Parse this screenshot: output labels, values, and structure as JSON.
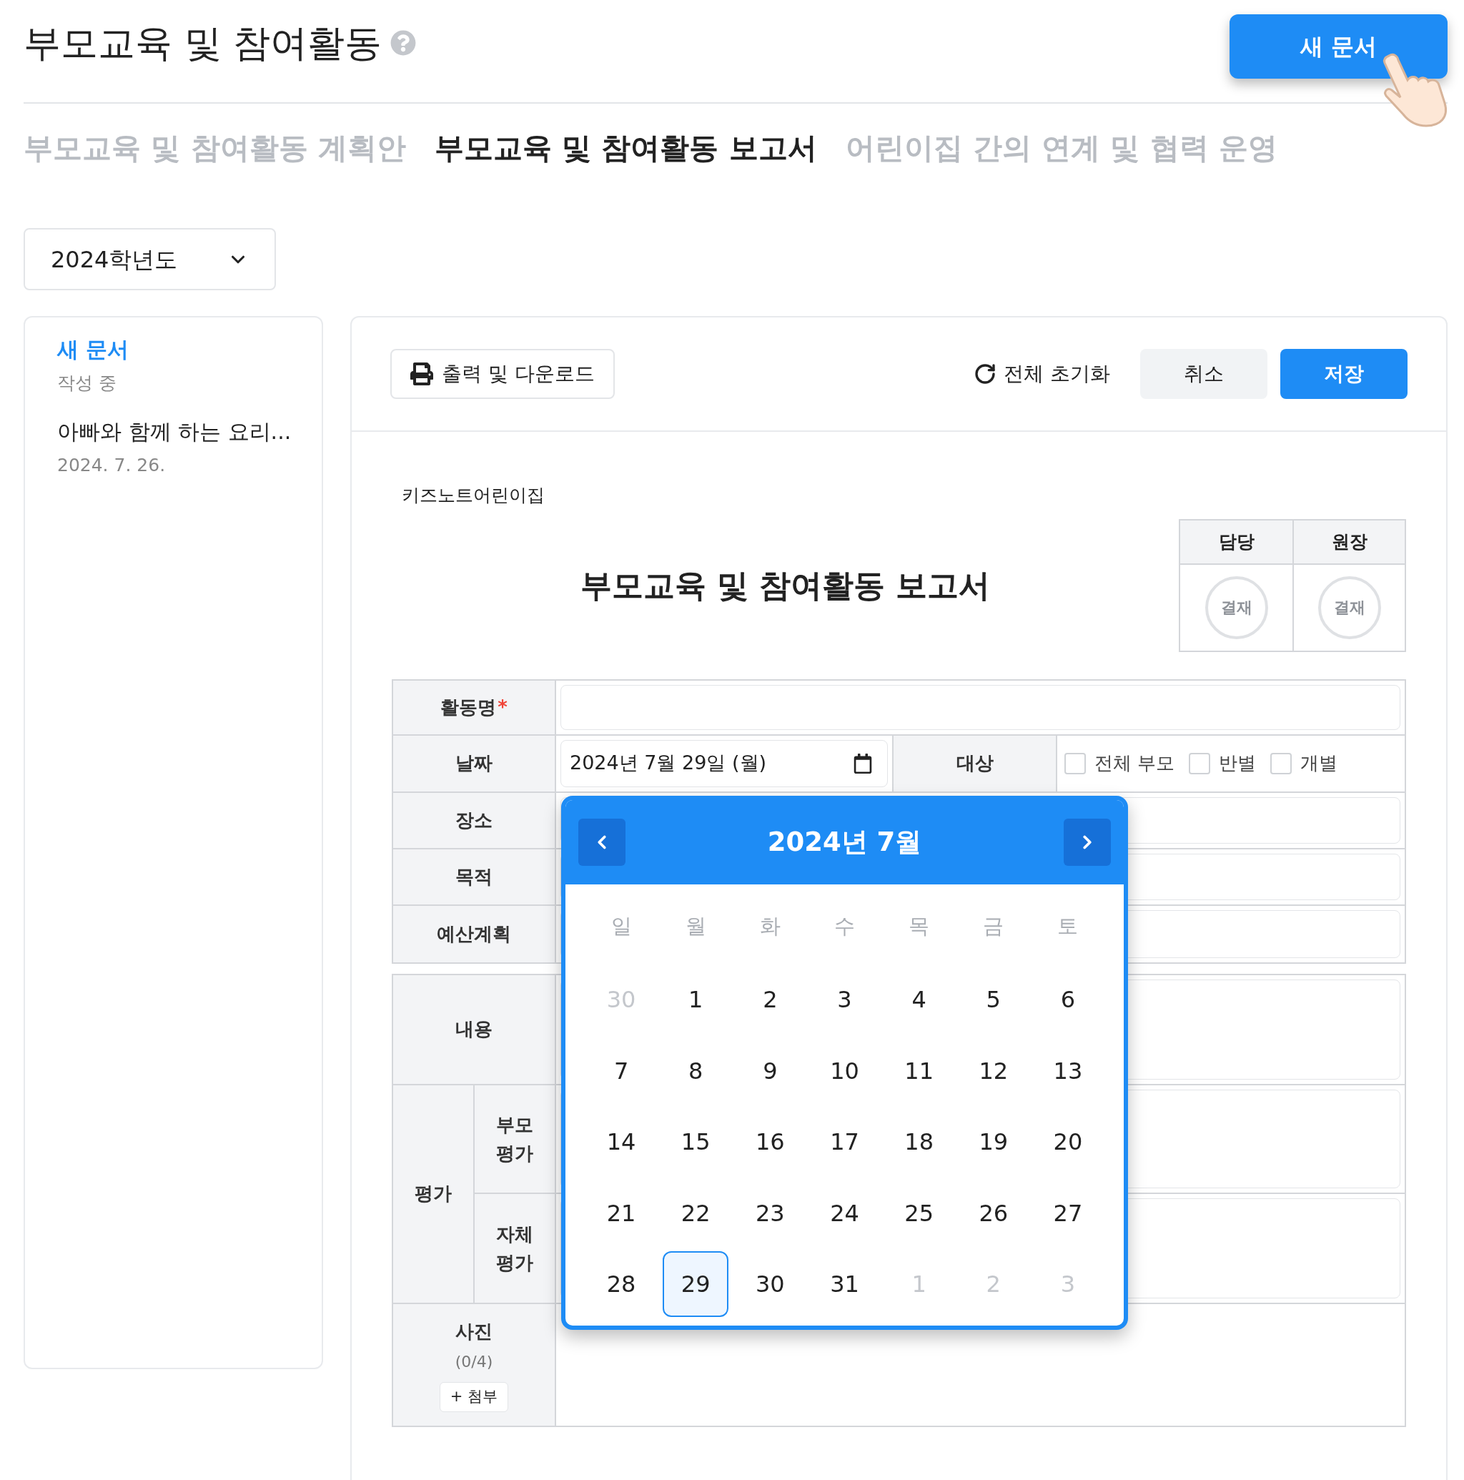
{
  "header": {
    "title": "부모교육 및 참여활동",
    "new_button": "새 문서"
  },
  "tabs": [
    {
      "label": "부모교육 및 참여활동 계획안",
      "selected": false
    },
    {
      "label": "부모교육 및 참여활동 보고서",
      "selected": true
    },
    {
      "label": "어린이집 간의 연계 및 협력 운영",
      "selected": false
    }
  ],
  "year_select": {
    "value": "2024학년도"
  },
  "sidebar": {
    "items": [
      {
        "title": "새 문서",
        "subtitle": "작성 중",
        "selected": true
      },
      {
        "title": "아빠와 함께 하는 요리...",
        "subtitle": "2024. 7. 26.",
        "selected": false
      }
    ]
  },
  "toolbar": {
    "print": "출력 및 다운로드",
    "reset": "전체 초기화",
    "cancel": "취소",
    "save": "저장"
  },
  "document": {
    "org": "키즈노트어린이집",
    "title": "부모교육 및 참여활동 보고서",
    "approvals": [
      {
        "role": "담당",
        "stamp": "결재"
      },
      {
        "role": "원장",
        "stamp": "결재"
      }
    ]
  },
  "form": {
    "activity": {
      "label": "활동명",
      "required_mark": "*"
    },
    "date": {
      "label": "날짜",
      "value": "2024년 7월 29일 (월)"
    },
    "target": {
      "label": "대상",
      "options": [
        {
          "label": "전체 부모",
          "checked": false
        },
        {
          "label": "반별",
          "checked": false
        },
        {
          "label": "개별",
          "checked": false
        }
      ]
    },
    "rows": [
      {
        "label": "장소"
      },
      {
        "label": "목적"
      },
      {
        "label": "예산계획"
      }
    ],
    "content": {
      "label": "내용"
    },
    "evaluation": {
      "label": "평가",
      "items": [
        {
          "label": "부모 평가"
        },
        {
          "label": "자체 평가"
        }
      ]
    },
    "photos": {
      "label": "사진",
      "count": "(0/4)",
      "attach": "+ 첨부"
    }
  },
  "calendar": {
    "title": "2024년 7월",
    "weekdays": [
      "일",
      "월",
      "화",
      "수",
      "목",
      "금",
      "토"
    ],
    "days": [
      {
        "label": "30",
        "outside": true,
        "selected": false
      },
      {
        "label": "1",
        "outside": false,
        "selected": false
      },
      {
        "label": "2",
        "outside": false,
        "selected": false
      },
      {
        "label": "3",
        "outside": false,
        "selected": false
      },
      {
        "label": "4",
        "outside": false,
        "selected": false
      },
      {
        "label": "5",
        "outside": false,
        "selected": false
      },
      {
        "label": "6",
        "outside": false,
        "selected": false
      },
      {
        "label": "7",
        "outside": false,
        "selected": false
      },
      {
        "label": "8",
        "outside": false,
        "selected": false
      },
      {
        "label": "9",
        "outside": false,
        "selected": false
      },
      {
        "label": "10",
        "outside": false,
        "selected": false
      },
      {
        "label": "11",
        "outside": false,
        "selected": false
      },
      {
        "label": "12",
        "outside": false,
        "selected": false
      },
      {
        "label": "13",
        "outside": false,
        "selected": false
      },
      {
        "label": "14",
        "outside": false,
        "selected": false
      },
      {
        "label": "15",
        "outside": false,
        "selected": false
      },
      {
        "label": "16",
        "outside": false,
        "selected": false
      },
      {
        "label": "17",
        "outside": false,
        "selected": false
      },
      {
        "label": "18",
        "outside": false,
        "selected": false
      },
      {
        "label": "19",
        "outside": false,
        "selected": false
      },
      {
        "label": "20",
        "outside": false,
        "selected": false
      },
      {
        "label": "21",
        "outside": false,
        "selected": false
      },
      {
        "label": "22",
        "outside": false,
        "selected": false
      },
      {
        "label": "23",
        "outside": false,
        "selected": false
      },
      {
        "label": "24",
        "outside": false,
        "selected": false
      },
      {
        "label": "25",
        "outside": false,
        "selected": false
      },
      {
        "label": "26",
        "outside": false,
        "selected": false
      },
      {
        "label": "27",
        "outside": false,
        "selected": false
      },
      {
        "label": "28",
        "outside": false,
        "selected": false
      },
      {
        "label": "29",
        "outside": false,
        "selected": true
      },
      {
        "label": "30",
        "outside": false,
        "selected": false
      },
      {
        "label": "31",
        "outside": false,
        "selected": false
      },
      {
        "label": "1",
        "outside": true,
        "selected": false
      },
      {
        "label": "2",
        "outside": true,
        "selected": false
      },
      {
        "label": "3",
        "outside": true,
        "selected": false
      }
    ]
  }
}
